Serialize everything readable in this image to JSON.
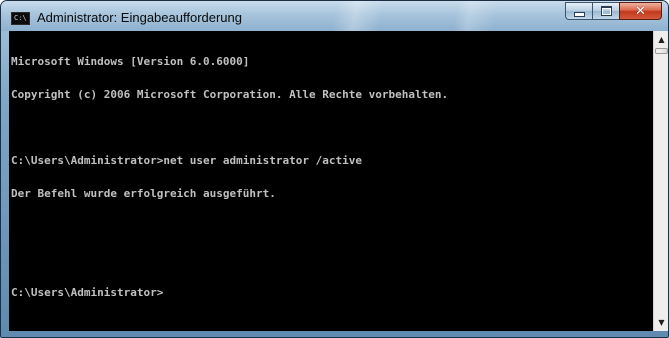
{
  "window": {
    "title": "Administrator: Eingabeaufforderung",
    "icon_text": "C:\\",
    "controls": {
      "minimize": "minimize-icon",
      "maximize": "maximize-icon",
      "close_glyph": "✕"
    }
  },
  "console": {
    "lines": [
      "Microsoft Windows [Version 6.0.6000]",
      "Copyright (c) 2006 Microsoft Corporation. Alle Rechte vorbehalten.",
      "",
      "C:\\Users\\Administrator>net user administrator /active",
      "Der Befehl wurde erfolgreich ausgeführt.",
      "",
      "",
      "C:\\Users\\Administrator>"
    ],
    "text_color": "#c0c0c0",
    "background": "#000000"
  },
  "scrollbar": {
    "up_glyph": "▲",
    "down_glyph": "▼"
  }
}
